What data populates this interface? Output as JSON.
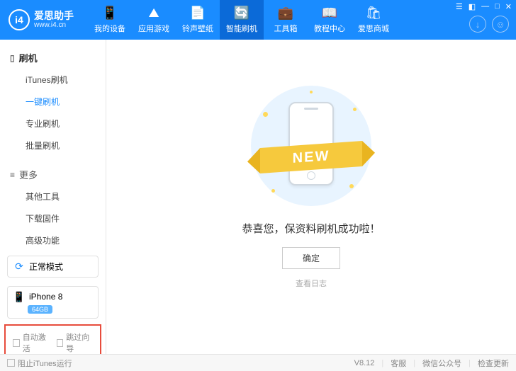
{
  "logo": {
    "badge": "i4",
    "title": "爱思助手",
    "url": "www.i4.cn"
  },
  "nav": [
    {
      "icon": "📱",
      "label": "我的设备"
    },
    {
      "icon": "⛰",
      "label": "应用游戏"
    },
    {
      "icon": "📄",
      "label": "铃声壁纸"
    },
    {
      "icon": "🔄",
      "label": "智能刷机"
    },
    {
      "icon": "💼",
      "label": "工具箱"
    },
    {
      "icon": "📖",
      "label": "教程中心"
    },
    {
      "icon": "🛍",
      "label": "爱思商城"
    }
  ],
  "sidebar": {
    "group1": {
      "title": "刷机",
      "items": [
        "iTunes刷机",
        "一键刷机",
        "专业刷机",
        "批量刷机"
      ]
    },
    "group2": {
      "title": "更多",
      "items": [
        "其他工具",
        "下载固件",
        "高级功能"
      ]
    }
  },
  "mode": {
    "label": "正常模式"
  },
  "device": {
    "name": "iPhone 8",
    "storage": "64GB"
  },
  "checks": {
    "auto_activate": "自动激活",
    "skip_guide": "跳过向导"
  },
  "main": {
    "ribbon": "NEW",
    "success": "恭喜您，保资料刷机成功啦！",
    "ok": "确定",
    "log": "查看日志"
  },
  "footer": {
    "block_itunes": "阻止iTunes运行",
    "version": "V8.12",
    "service": "客服",
    "wechat": "微信公众号",
    "update": "检查更新"
  }
}
